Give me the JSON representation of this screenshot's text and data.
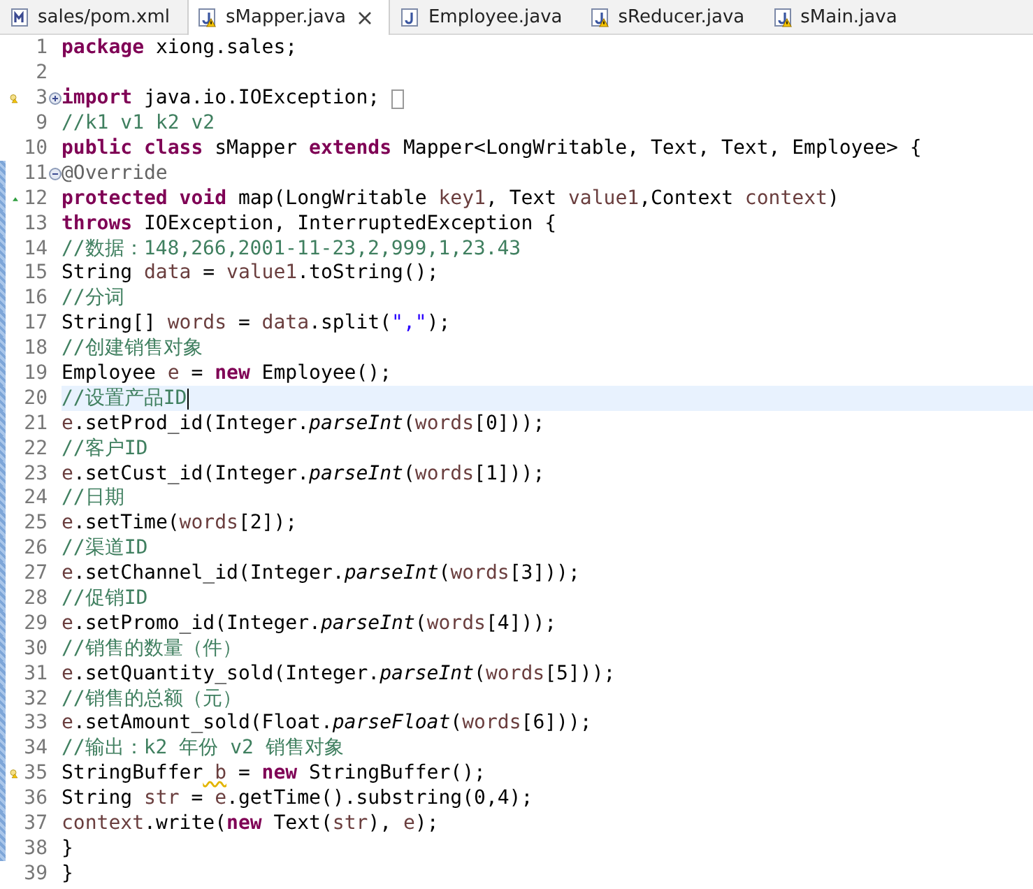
{
  "tabs": [
    {
      "label": "sales/pom.xml",
      "kind": "xml",
      "warning": false,
      "selected": false
    },
    {
      "label": "sMapper.java",
      "kind": "java",
      "warning": true,
      "selected": true
    },
    {
      "label": "Employee.java",
      "kind": "java",
      "warning": false,
      "selected": false
    },
    {
      "label": "sReducer.java",
      "kind": "java",
      "warning": true,
      "selected": false
    },
    {
      "label": "sMain.java",
      "kind": "java",
      "warning": true,
      "selected": false
    }
  ],
  "editor": {
    "lines": [
      {
        "number": "1",
        "warning": false,
        "override": false,
        "collapsed": false,
        "expanded": false,
        "changed": false,
        "current": false,
        "tokens": [
          {
            "kind": "keyword",
            "text": "package"
          },
          {
            "kind": "plain",
            "text": " xiong.sales;"
          }
        ]
      },
      {
        "number": "2",
        "warning": false,
        "override": false,
        "collapsed": false,
        "expanded": false,
        "changed": false,
        "current": false
      },
      {
        "number": "3",
        "warning": true,
        "override": false,
        "collapsed": true,
        "expanded": false,
        "changed": false,
        "current": false,
        "tokens": [
          {
            "kind": "keyword",
            "text": "import"
          },
          {
            "kind": "plain",
            "text": " java.io.IOException;"
          }
        ]
      },
      {
        "number": "9",
        "warning": false,
        "override": false,
        "collapsed": false,
        "expanded": false,
        "changed": false,
        "current": false,
        "tokens": [
          {
            "kind": "comment",
            "text": "//k1 v1 k2 v2"
          }
        ]
      },
      {
        "number": "10",
        "warning": false,
        "override": false,
        "collapsed": false,
        "expanded": false,
        "changed": false,
        "current": false,
        "tokens": [
          {
            "kind": "keyword",
            "text": "public"
          },
          {
            "kind": "keyword",
            "text": " class"
          },
          {
            "kind": "plain",
            "text": " sMapper"
          },
          {
            "kind": "keyword",
            "text": " extends"
          },
          {
            "kind": "plain",
            "text": " Mapper<LongWritable, Text, Text, Employee> {"
          }
        ]
      },
      {
        "number": "11",
        "warning": false,
        "override": false,
        "collapsed": false,
        "expanded": true,
        "changed": true,
        "current": false,
        "tokens": [
          {
            "kind": "annotation",
            "text": "@Override"
          }
        ]
      },
      {
        "number": "12",
        "warning": false,
        "override": true,
        "collapsed": false,
        "expanded": false,
        "changed": true,
        "current": false,
        "tokens": [
          {
            "kind": "keyword",
            "text": "protected"
          },
          {
            "kind": "keyword",
            "text": " void"
          },
          {
            "kind": "plain",
            "text": " map(LongWritable"
          },
          {
            "kind": "variable",
            "text": " key1"
          },
          {
            "kind": "plain",
            "text": ", Text"
          },
          {
            "kind": "variable",
            "text": " value1"
          },
          {
            "kind": "plain",
            "text": ",Context"
          },
          {
            "kind": "variable",
            "text": " context"
          },
          {
            "kind": "plain",
            "text": ")"
          }
        ]
      },
      {
        "number": "13",
        "warning": false,
        "override": false,
        "collapsed": false,
        "expanded": false,
        "changed": true,
        "current": false,
        "tokens": [
          {
            "kind": "keyword",
            "text": "throws"
          },
          {
            "kind": "plain",
            "text": " IOException, InterruptedException {"
          }
        ]
      },
      {
        "number": "14",
        "warning": false,
        "override": false,
        "collapsed": false,
        "expanded": false,
        "changed": true,
        "current": false,
        "tokens": [
          {
            "kind": "comment",
            "text": "//数据：148,266,2001-11-23,2,999,1,23.43"
          }
        ]
      },
      {
        "number": "15",
        "warning": false,
        "override": false,
        "collapsed": false,
        "expanded": false,
        "changed": true,
        "current": false,
        "tokens": [
          {
            "kind": "plain",
            "text": "String"
          },
          {
            "kind": "variable",
            "text": " data"
          },
          {
            "kind": "plain",
            "text": " ="
          },
          {
            "kind": "variable",
            "text": " value1"
          },
          {
            "kind": "plain",
            "text": ".toString();"
          }
        ]
      },
      {
        "number": "16",
        "warning": false,
        "override": false,
        "collapsed": false,
        "expanded": false,
        "changed": true,
        "current": false,
        "tokens": [
          {
            "kind": "comment",
            "text": "//分词"
          }
        ]
      },
      {
        "number": "17",
        "warning": false,
        "override": false,
        "collapsed": false,
        "expanded": false,
        "changed": true,
        "current": false,
        "tokens": [
          {
            "kind": "plain",
            "text": "String[]"
          },
          {
            "kind": "variable",
            "text": " words"
          },
          {
            "kind": "plain",
            "text": " ="
          },
          {
            "kind": "variable",
            "text": " data"
          },
          {
            "kind": "plain",
            "text": ".split("
          },
          {
            "kind": "string",
            "text": "\",\""
          },
          {
            "kind": "plain",
            "text": ");"
          }
        ]
      },
      {
        "number": "18",
        "warning": false,
        "override": false,
        "collapsed": false,
        "expanded": false,
        "changed": true,
        "current": false,
        "tokens": [
          {
            "kind": "comment",
            "text": "//创建销售对象"
          }
        ]
      },
      {
        "number": "19",
        "warning": false,
        "override": false,
        "collapsed": false,
        "expanded": false,
        "changed": true,
        "current": false,
        "tokens": [
          {
            "kind": "plain",
            "text": "Employee"
          },
          {
            "kind": "variable",
            "text": " e"
          },
          {
            "kind": "plain",
            "text": " ="
          },
          {
            "kind": "keyword",
            "text": " new"
          },
          {
            "kind": "plain",
            "text": " Employee();"
          }
        ]
      },
      {
        "number": "20",
        "warning": false,
        "override": false,
        "collapsed": false,
        "expanded": false,
        "changed": true,
        "current": true,
        "tokens": [
          {
            "kind": "comment",
            "text": "//设置产品ID"
          }
        ]
      },
      {
        "number": "21",
        "warning": false,
        "override": false,
        "collapsed": false,
        "expanded": false,
        "changed": true,
        "current": false,
        "tokens": [
          {
            "kind": "variable",
            "text": "e"
          },
          {
            "kind": "plain",
            "text": ".setProd_id(Integer."
          },
          {
            "kind": "static",
            "text": "parseInt"
          },
          {
            "kind": "plain",
            "text": "("
          },
          {
            "kind": "variable",
            "text": "words"
          },
          {
            "kind": "plain",
            "text": "[0]));"
          }
        ]
      },
      {
        "number": "22",
        "warning": false,
        "override": false,
        "collapsed": false,
        "expanded": false,
        "changed": true,
        "current": false,
        "tokens": [
          {
            "kind": "comment",
            "text": "//客户ID"
          }
        ]
      },
      {
        "number": "23",
        "warning": false,
        "override": false,
        "collapsed": false,
        "expanded": false,
        "changed": true,
        "current": false,
        "tokens": [
          {
            "kind": "variable",
            "text": "e"
          },
          {
            "kind": "plain",
            "text": ".setCust_id(Integer."
          },
          {
            "kind": "static",
            "text": "parseInt"
          },
          {
            "kind": "plain",
            "text": "("
          },
          {
            "kind": "variable",
            "text": "words"
          },
          {
            "kind": "plain",
            "text": "[1]));"
          }
        ]
      },
      {
        "number": "24",
        "warning": false,
        "override": false,
        "collapsed": false,
        "expanded": false,
        "changed": true,
        "current": false,
        "tokens": [
          {
            "kind": "comment",
            "text": "//日期"
          }
        ]
      },
      {
        "number": "25",
        "warning": false,
        "override": false,
        "collapsed": false,
        "expanded": false,
        "changed": true,
        "current": false,
        "tokens": [
          {
            "kind": "variable",
            "text": "e"
          },
          {
            "kind": "plain",
            "text": ".setTime("
          },
          {
            "kind": "variable",
            "text": "words"
          },
          {
            "kind": "plain",
            "text": "[2]);"
          }
        ]
      },
      {
        "number": "26",
        "warning": false,
        "override": false,
        "collapsed": false,
        "expanded": false,
        "changed": true,
        "current": false,
        "tokens": [
          {
            "kind": "comment",
            "text": "//渠道ID"
          }
        ]
      },
      {
        "number": "27",
        "warning": false,
        "override": false,
        "collapsed": false,
        "expanded": false,
        "changed": true,
        "current": false,
        "tokens": [
          {
            "kind": "variable",
            "text": "e"
          },
          {
            "kind": "plain",
            "text": ".setChannel_id(Integer."
          },
          {
            "kind": "static",
            "text": "parseInt"
          },
          {
            "kind": "plain",
            "text": "("
          },
          {
            "kind": "variable",
            "text": "words"
          },
          {
            "kind": "plain",
            "text": "[3]));"
          }
        ]
      },
      {
        "number": "28",
        "warning": false,
        "override": false,
        "collapsed": false,
        "expanded": false,
        "changed": true,
        "current": false,
        "tokens": [
          {
            "kind": "comment",
            "text": "//促销ID"
          }
        ]
      },
      {
        "number": "29",
        "warning": false,
        "override": false,
        "collapsed": false,
        "expanded": false,
        "changed": true,
        "current": false,
        "tokens": [
          {
            "kind": "variable",
            "text": "e"
          },
          {
            "kind": "plain",
            "text": ".setPromo_id(Integer."
          },
          {
            "kind": "static",
            "text": "parseInt"
          },
          {
            "kind": "plain",
            "text": "("
          },
          {
            "kind": "variable",
            "text": "words"
          },
          {
            "kind": "plain",
            "text": "[4]));"
          }
        ]
      },
      {
        "number": "30",
        "warning": false,
        "override": false,
        "collapsed": false,
        "expanded": false,
        "changed": true,
        "current": false,
        "tokens": [
          {
            "kind": "comment",
            "text": "//销售的数量（件）"
          }
        ]
      },
      {
        "number": "31",
        "warning": false,
        "override": false,
        "collapsed": false,
        "expanded": false,
        "changed": true,
        "current": false,
        "tokens": [
          {
            "kind": "variable",
            "text": "e"
          },
          {
            "kind": "plain",
            "text": ".setQuantity_sold(Integer."
          },
          {
            "kind": "static",
            "text": "parseInt"
          },
          {
            "kind": "plain",
            "text": "("
          },
          {
            "kind": "variable",
            "text": "words"
          },
          {
            "kind": "plain",
            "text": "[5]));"
          }
        ]
      },
      {
        "number": "32",
        "warning": false,
        "override": false,
        "collapsed": false,
        "expanded": false,
        "changed": true,
        "current": false,
        "tokens": [
          {
            "kind": "comment",
            "text": "//销售的总额（元）"
          }
        ]
      },
      {
        "number": "33",
        "warning": false,
        "override": false,
        "collapsed": false,
        "expanded": false,
        "changed": true,
        "current": false,
        "tokens": [
          {
            "kind": "variable",
            "text": "e"
          },
          {
            "kind": "plain",
            "text": ".setAmount_sold(Float."
          },
          {
            "kind": "static",
            "text": "parseFloat"
          },
          {
            "kind": "plain",
            "text": "("
          },
          {
            "kind": "variable",
            "text": "words"
          },
          {
            "kind": "plain",
            "text": "[6]));"
          }
        ]
      },
      {
        "number": "34",
        "warning": false,
        "override": false,
        "collapsed": false,
        "expanded": false,
        "changed": true,
        "current": false,
        "tokens": [
          {
            "kind": "comment",
            "text": "//输出：k2 年份 v2 销售对象"
          }
        ]
      },
      {
        "number": "35",
        "warning": true,
        "override": false,
        "collapsed": false,
        "expanded": false,
        "changed": true,
        "current": false,
        "tokens": [
          {
            "kind": "plain",
            "text": "StringBuffer"
          },
          {
            "kind": "unused",
            "text": " b"
          },
          {
            "kind": "plain",
            "text": " ="
          },
          {
            "kind": "keyword",
            "text": " new"
          },
          {
            "kind": "plain",
            "text": " StringBuffer();"
          }
        ]
      },
      {
        "number": "36",
        "warning": false,
        "override": false,
        "collapsed": false,
        "expanded": false,
        "changed": true,
        "current": false,
        "tokens": [
          {
            "kind": "plain",
            "text": "String"
          },
          {
            "kind": "variable",
            "text": " str"
          },
          {
            "kind": "plain",
            "text": " ="
          },
          {
            "kind": "variable",
            "text": " e"
          },
          {
            "kind": "plain",
            "text": ".getTime().substring(0,4);"
          }
        ]
      },
      {
        "number": "37",
        "warning": false,
        "override": false,
        "collapsed": false,
        "expanded": false,
        "changed": true,
        "current": false,
        "tokens": [
          {
            "kind": "variable",
            "text": "context"
          },
          {
            "kind": "plain",
            "text": ".write("
          },
          {
            "kind": "keyword",
            "text": "new"
          },
          {
            "kind": "plain",
            "text": " Text("
          },
          {
            "kind": "variable",
            "text": "str"
          },
          {
            "kind": "plain",
            "text": "),"
          },
          {
            "kind": "variable",
            "text": " e"
          },
          {
            "kind": "plain",
            "text": ");"
          }
        ]
      },
      {
        "number": "38",
        "warning": false,
        "override": false,
        "collapsed": false,
        "expanded": false,
        "changed": true,
        "current": false,
        "tokens": [
          {
            "kind": "plain",
            "text": "}"
          }
        ]
      },
      {
        "number": "39",
        "warning": false,
        "override": false,
        "collapsed": false,
        "expanded": false,
        "changed": false,
        "current": false,
        "tokens": [
          {
            "kind": "plain",
            "text": "}"
          }
        ]
      }
    ]
  }
}
